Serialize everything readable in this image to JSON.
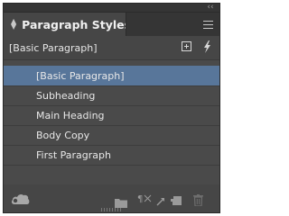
{
  "panel": {
    "title": "Paragraph Styles",
    "current_style": "[Basic Paragraph]"
  },
  "styles": [
    {
      "label": "[Basic Paragraph]",
      "selected": true
    },
    {
      "label": "Subheading",
      "selected": false
    },
    {
      "label": "Main Heading",
      "selected": false
    },
    {
      "label": "Body Copy",
      "selected": false
    },
    {
      "label": "First Paragraph",
      "selected": false
    }
  ],
  "icons": {
    "collapse": "double-chevron-left-icon",
    "tab_arrows": "up-down-arrows-icon",
    "menu": "hamburger-menu-icon",
    "add_selected": "create-style-from-selection-icon",
    "quick_apply": "lightning-bolt-icon",
    "cc_libraries": "creative-cloud-icon",
    "new_group": "folder-icon",
    "clear_overrides": "clear-overrides-icon",
    "redefine": "redefine-style-icon",
    "new_style": "new-style-icon",
    "delete": "trash-icon"
  },
  "colors": {
    "panel_bg": "#464646",
    "selection": "#58769a",
    "text": "#e8e8e8"
  }
}
